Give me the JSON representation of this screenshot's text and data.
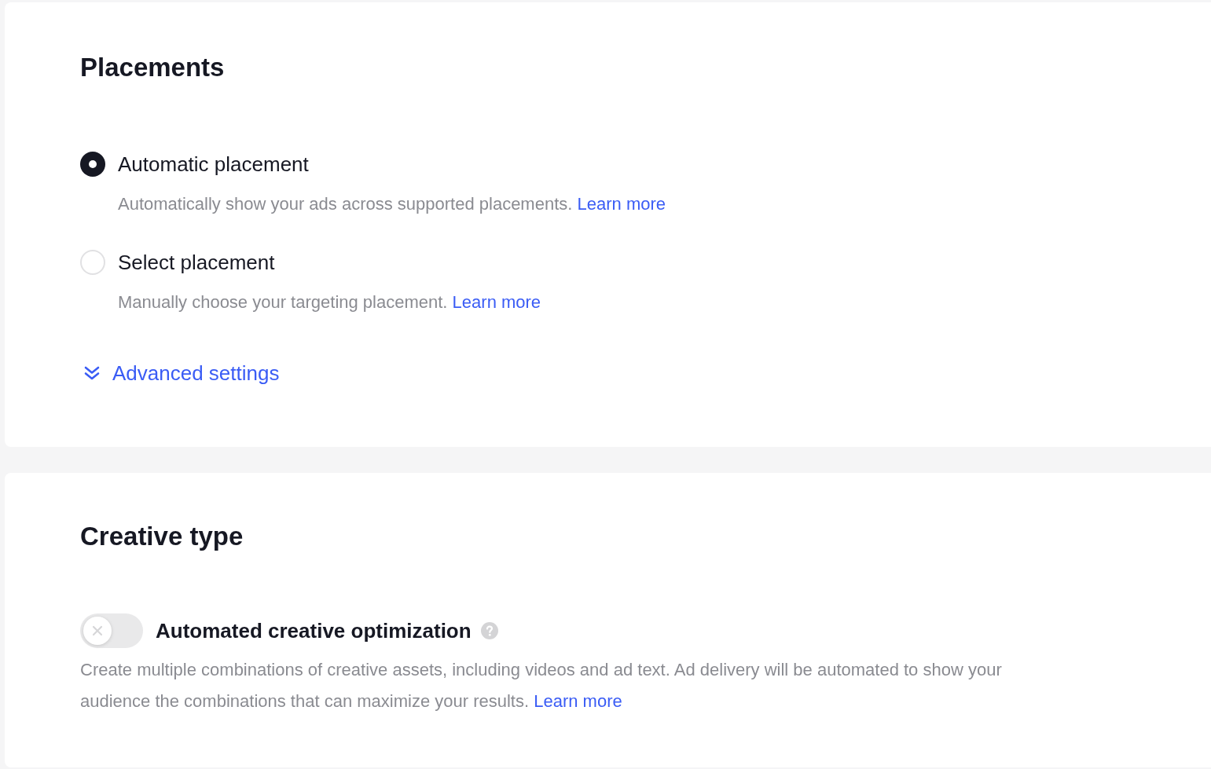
{
  "placements": {
    "title": "Placements",
    "options": [
      {
        "label": "Automatic placement",
        "description": "Automatically show your ads across supported placements.",
        "link": "Learn more",
        "selected": true
      },
      {
        "label": "Select placement",
        "description": "Manually choose your targeting placement.",
        "link": "Learn more",
        "selected": false
      }
    ],
    "advanced_settings": {
      "label": "Advanced settings",
      "expanded": false
    }
  },
  "creative_type": {
    "title": "Creative type",
    "setting": {
      "label": "Automated creative optimization",
      "on": false,
      "description": "Create multiple combinations of creative assets, including videos and ad text. Ad delivery will be automated to show your audience the combinations that can maximize your results.",
      "link": "Learn more"
    }
  }
}
